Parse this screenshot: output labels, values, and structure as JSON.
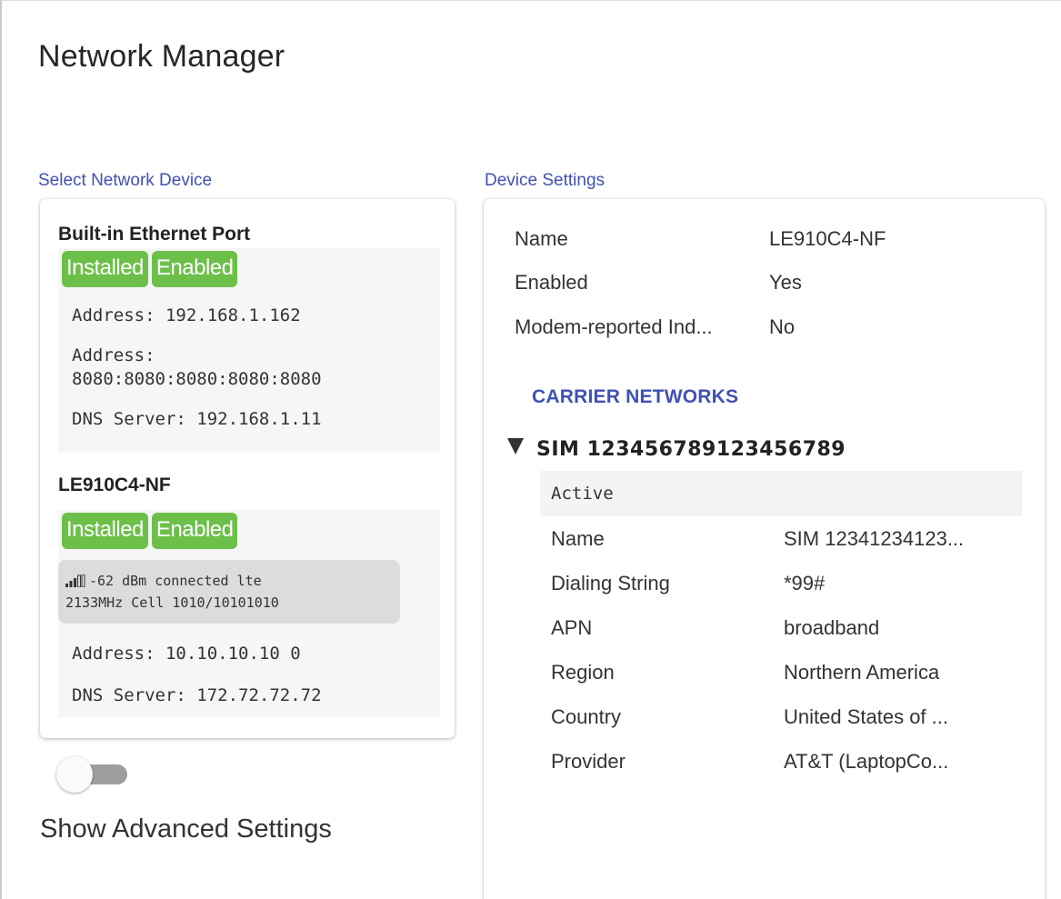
{
  "app": {
    "title": "Network Manager"
  },
  "left": {
    "section_label": "Select Network Device",
    "devices": [
      {
        "name": "Built-in Ethernet Port",
        "badges": [
          "Installed",
          "Enabled"
        ],
        "lines": [
          "Address: 192.168.1.162",
          "Address:",
          "8080:8080:8080:8080:8080",
          "DNS Server: 192.168.1.11"
        ]
      },
      {
        "name": "LE910C4-NF",
        "badges": [
          "Installed",
          "Enabled"
        ],
        "signal": {
          "icon": "signal-strength-icon",
          "line1": "-62 dBm connected lte",
          "line2": "2133MHz Cell 1010/10101010"
        },
        "lines": [
          "Address: 10.10.10.10 0",
          "DNS Server: 172.72.72.72"
        ]
      }
    ],
    "advanced_toggle": {
      "label": "Show Advanced Settings",
      "checked": false
    }
  },
  "right": {
    "section_label": "Device Settings",
    "settings": [
      {
        "key": "Name",
        "value": "LE910C4-NF"
      },
      {
        "key": "Enabled",
        "value": "Yes"
      },
      {
        "key": "Modem-reported Ind...",
        "value": "No"
      }
    ],
    "carrier_title": "CARRIER NETWORKS",
    "sim": {
      "id": "SIM 123456789123456789",
      "status": "Active",
      "rows": [
        {
          "key": "Name",
          "value": "SIM 12341234123..."
        },
        {
          "key": "Dialing String",
          "value": "*99#"
        },
        {
          "key": "APN",
          "value": "broadband"
        },
        {
          "key": "Region",
          "value": "Northern America"
        },
        {
          "key": "Country",
          "value": "United States of ..."
        },
        {
          "key": "Provider",
          "value": "AT&T (LaptopCo..."
        }
      ]
    }
  },
  "colors": {
    "accent": "#3f51b5",
    "badge": "#6cc04a"
  }
}
